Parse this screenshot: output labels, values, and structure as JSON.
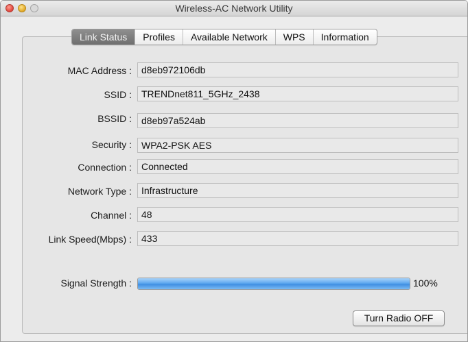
{
  "window": {
    "title": "Wireless-AC Network Utility"
  },
  "tabs": [
    "Link Status",
    "Profiles",
    "Available Network",
    "WPS",
    "Information"
  ],
  "fields": [
    {
      "label": "MAC Address :",
      "value": "d8eb972106db"
    },
    {
      "label": "SSID :",
      "value": "TRENDnet811_5GHz_2438"
    },
    {
      "label": "BSSID :",
      "value": "d8eb97a524ab"
    },
    {
      "label": "Security :",
      "value": "WPA2-PSK AES"
    },
    {
      "label": "Connection :",
      "value": "Connected"
    },
    {
      "label": "Network Type :",
      "value": "Infrastructure"
    },
    {
      "label": "Channel :",
      "value": "48"
    },
    {
      "label": "Link Speed(Mbps) :",
      "value": "433"
    }
  ],
  "signal": {
    "label": "Signal Strength :",
    "percent_text": "100%",
    "level": 1.0
  },
  "buttons": {
    "radio_toggle": "Turn Radio OFF"
  }
}
